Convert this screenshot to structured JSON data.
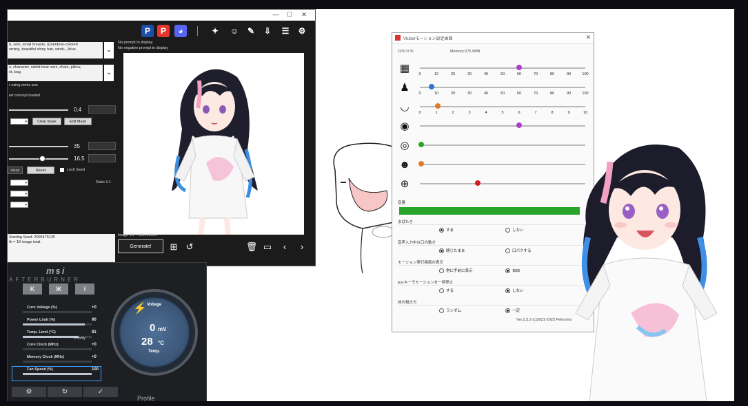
{
  "sd_window": {
    "controls": {
      "minimize": "—",
      "maximize": "☐",
      "close": "✕"
    },
    "toolbar_icons": [
      "paypal-icon",
      "patreon-icon",
      "discord-icon",
      "wand-icon",
      "face-icon",
      "wrench-icon",
      "download-icon",
      "list-icon",
      "gear-icon"
    ],
    "prompt_positive": "t), solo, small breasts, (((rainbow-colored\norning, beautiful shiny hair, wind+, (blue",
    "prompt_negative": "e, character, rabbit bear ears, chain, pillow,\net, bag,",
    "no_prompt": "No prompt to display",
    "no_negative": "No negative prompt to display",
    "status_1": "r using somc.ane",
    "status_2": "ed concept loaded.",
    "slider_1_value": "0.4",
    "clear_mask": "Clear Mask",
    "edit_mask": "Edit Mask",
    "slider_2_value": "35",
    "slider_3_value": "16.5",
    "previous_label": "vious",
    "reset_label": "Reset",
    "lock_seed": "Lock Seed",
    "ratio": "Ratio 1:1",
    "log_text": "Starting Seed: 2005475125\nth = 18 image total.",
    "image_info": "Image 1/1  -  1024x1024",
    "generate": "Generate!",
    "slider_progress": {
      "s1": 0.4,
      "s2": 0.35,
      "s3": 0.55
    }
  },
  "msi": {
    "logo": "msi",
    "subtitle": "AFTERBURNER",
    "tabs": [
      "K",
      "Ж",
      "i"
    ],
    "rows": [
      {
        "label": "Core Voltage (%)",
        "value": "+0",
        "fill": 0.0
      },
      {
        "label": "Power Limit (%)",
        "value": "90",
        "fill": 0.9
      },
      {
        "label": "Temp. Limit (°C)",
        "value": "81",
        "fill": 0.81
      },
      {
        "label": "Core Clock (MHz)",
        "value": "+0",
        "fill": 0.0
      },
      {
        "label": "Memory Clock (MHz)",
        "value": "+0",
        "fill": 0.0
      },
      {
        "label": "Fan Speed (%)",
        "value": "100",
        "fill": 1.0
      }
    ],
    "priority": "Priority",
    "gauge": {
      "voltage_label": "Voltage",
      "mv": "0",
      "mv_unit": "mV",
      "temp": "28",
      "temp_unit": "°C",
      "temp_label": "Temp."
    },
    "profile": "Profile"
  },
  "motion": {
    "title": "Vtuberモーション設定画面",
    "cpu": "CPU:0 %",
    "memory": "Memory:275.0MB",
    "sliders": [
      {
        "icon": "film-icon",
        "value": 60,
        "max": 100,
        "color": "#b33bc9",
        "scale": [
          "0",
          "10",
          "20",
          "30",
          "40",
          "50",
          "60",
          "70",
          "80",
          "90",
          "100"
        ]
      },
      {
        "icon": "body-icon",
        "value": 7,
        "max": 100,
        "color": "#2f74d0",
        "scale": [
          "0",
          "10",
          "20",
          "30",
          "40",
          "50",
          "60",
          "70",
          "80",
          "90",
          "100"
        ]
      },
      {
        "icon": "mouth-icon",
        "value": 1.1,
        "max": 10,
        "color": "#e07b2e",
        "scale": [
          "0",
          "1",
          "2",
          "3",
          "4",
          "5",
          "6",
          "7",
          "8",
          "9",
          "10"
        ]
      },
      {
        "icon": "eye-wink-icon",
        "value": 60,
        "max": 100,
        "color": "#b33bc9",
        "scale": []
      },
      {
        "icon": "eye-icon",
        "value": 1,
        "max": 100,
        "color": "#2aa52a",
        "scale": []
      },
      {
        "icon": "smile-icon",
        "value": 1,
        "max": 100,
        "color": "#e07b2e",
        "scale": []
      },
      {
        "icon": "zoom-icon",
        "value": 35,
        "max": 100,
        "color": "#d42020",
        "scale": []
      }
    ],
    "volume_label": "音量",
    "groups": [
      {
        "label": "まばたき",
        "options": [
          "する",
          "しない"
        ],
        "selected": 0
      },
      {
        "label": "音声入力中以口の動き",
        "options": [
          "閉じたまま",
          "口パクする"
        ],
        "selected": 0
      },
      {
        "label": "モーション実行画面の表示",
        "options": [
          "常に手前に表示",
          "自由"
        ],
        "selected": 1
      },
      {
        "label": "Escキーでモーションを一時停止",
        "options": [
          "する",
          "しない"
        ],
        "selected": 1
      },
      {
        "label": "体の傾き方",
        "options": [
          "ランダム",
          "一定"
        ],
        "selected": 1
      }
    ],
    "version": "Ver.2.3.2 (c)2021-2023 Pelinomo"
  }
}
